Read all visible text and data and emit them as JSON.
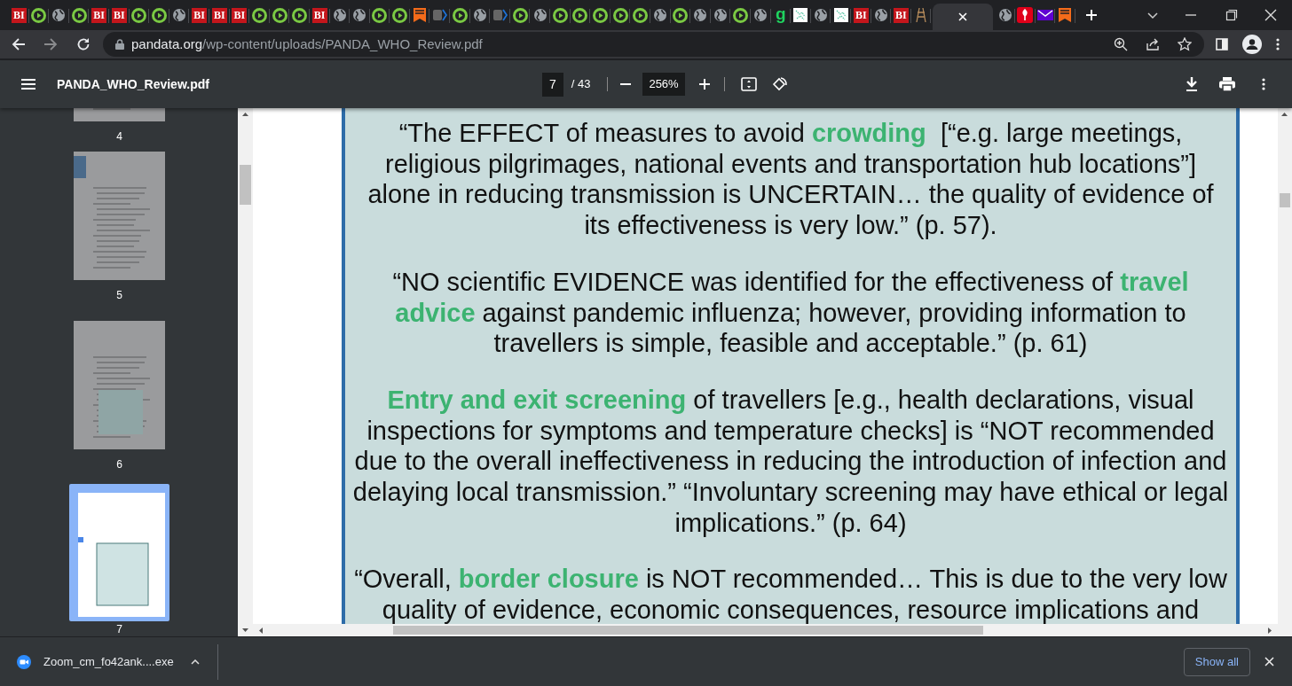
{
  "browser_tabs": [
    {
      "kind": "bi",
      "label": "BI",
      "selected": false
    },
    {
      "kind": "play",
      "selected": false
    },
    {
      "kind": "globe",
      "selected": false
    },
    {
      "kind": "play",
      "selected": false
    },
    {
      "kind": "bi",
      "label": "BI",
      "selected": false
    },
    {
      "kind": "bi",
      "label": "BI",
      "selected": false
    },
    {
      "kind": "play",
      "selected": false
    },
    {
      "kind": "play",
      "selected": false
    },
    {
      "kind": "globe",
      "selected": false
    },
    {
      "kind": "bi",
      "label": "BI",
      "selected": false
    },
    {
      "kind": "bi",
      "label": "BI",
      "selected": false
    },
    {
      "kind": "bi",
      "label": "BI",
      "selected": false
    },
    {
      "kind": "play",
      "selected": false
    },
    {
      "kind": "play",
      "selected": false
    },
    {
      "kind": "play",
      "selected": false
    },
    {
      "kind": "bi",
      "label": "BI",
      "selected": false
    },
    {
      "kind": "globe",
      "selected": false
    },
    {
      "kind": "globe",
      "selected": false
    },
    {
      "kind": "play",
      "selected": false
    },
    {
      "kind": "play",
      "selected": false
    },
    {
      "kind": "bookmark",
      "selected": false
    },
    {
      "kind": "chevron",
      "selected": false
    },
    {
      "kind": "play",
      "selected": false
    },
    {
      "kind": "globe",
      "selected": false
    },
    {
      "kind": "chevron",
      "selected": false
    },
    {
      "kind": "play",
      "selected": false
    },
    {
      "kind": "globe",
      "selected": false
    },
    {
      "kind": "play",
      "selected": false
    },
    {
      "kind": "play",
      "selected": false
    },
    {
      "kind": "play",
      "selected": false
    },
    {
      "kind": "play",
      "selected": false
    },
    {
      "kind": "play",
      "selected": false
    },
    {
      "kind": "globe",
      "selected": false
    },
    {
      "kind": "play",
      "selected": false
    },
    {
      "kind": "globe",
      "selected": false
    },
    {
      "kind": "globe",
      "selected": false
    },
    {
      "kind": "play",
      "selected": false
    },
    {
      "kind": "globe",
      "selected": false
    },
    {
      "kind": "g",
      "label": "g",
      "selected": false
    },
    {
      "kind": "grid",
      "selected": false
    },
    {
      "kind": "globe",
      "selected": false
    },
    {
      "kind": "grid",
      "selected": false
    },
    {
      "kind": "bi",
      "label": "BI",
      "selected": false
    },
    {
      "kind": "globe",
      "selected": false
    },
    {
      "kind": "bi",
      "label": "BI",
      "selected": false
    },
    {
      "kind": "ladder",
      "selected": false
    },
    {
      "kind": "blank",
      "selected": true
    },
    {
      "kind": "globe",
      "selected": false
    },
    {
      "kind": "pin",
      "selected": false
    },
    {
      "kind": "mail",
      "selected": false
    },
    {
      "kind": "bookmark",
      "selected": false
    }
  ],
  "address_bar": {
    "host": "pandata.org",
    "path": "/wp-content/uploads/PANDA_WHO_Review.pdf"
  },
  "pdf_toolbar": {
    "file_name": "PANDA_WHO_Review.pdf",
    "page": "7",
    "page_total": "/ 43",
    "zoom": "256%"
  },
  "thumbnails": [
    {
      "page_label": "4",
      "selected": false
    },
    {
      "page_label": "5",
      "selected": false
    },
    {
      "page_label": "6",
      "selected": false
    },
    {
      "page_label": "7",
      "selected": true
    }
  ],
  "document": {
    "paragraphs": [
      "“The EFFECT of measures to avoid **crowding**  [“e.g. large meetings, religious pilgrimages, national events and transportation hub locations”] alone in reducing transmission is UNCERTAIN… the quality of evidence of its effectiveness is very low.” (p. 57).",
      "“NO scientific EVIDENCE was identified for the effectiveness of **travel advice** against pandemic influenza; however, providing information to travellers is simple, feasible and acceptable.” (p. 61)",
      "**Entry and exit screening** of travellers [e.g., health declarations, visual inspections for symptoms and temperature checks] is “NOT recommended due to the overall ineffectiveness in reducing the introduction of infection and delaying local transmission.” “Involuntary screening may have ethical or legal implications.” (p. 64)",
      "“Overall, **border closure** is NOT recommended… This is due to the very low quality of evidence, economic consequences, resource implications and"
    ]
  },
  "download_bar": {
    "file_name": "Zoom_cm_fo42ank....exe",
    "show_all": "Show all"
  }
}
